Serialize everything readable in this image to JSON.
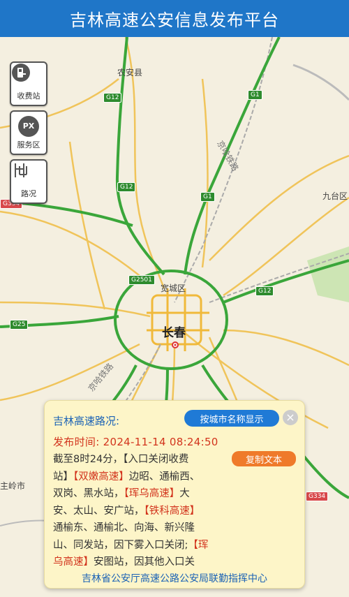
{
  "header": {
    "title": "吉林高速公安信息发布平台"
  },
  "side_buttons": [
    {
      "label": "收费站",
      "icon": "toll-station-icon"
    },
    {
      "label": "服务区",
      "icon": "service-area-icon",
      "icon_text": "PX"
    },
    {
      "label": "路况",
      "icon": "road-condition-icon"
    }
  ],
  "map": {
    "places": {
      "nongan": "农安县",
      "kuancheng": "宽城区",
      "changchun": "长春",
      "jiutai": "九台区",
      "zhuling": "主岭市",
      "railway1": "京哈铁路",
      "railway2": "京哈铁路"
    },
    "shields": {
      "g12a": "G12",
      "g12b": "G12",
      "g12c": "G12",
      "g1a": "G1",
      "g1b": "G1",
      "g2501": "G2501",
      "g25": "G25",
      "g334a": "G334",
      "g334b": "G334"
    },
    "colors": {
      "background": "#f4efe0",
      "expressway": "#3aa63a",
      "highway": "#f0c45a",
      "railway": "#999999"
    }
  },
  "panel": {
    "title": "吉林高速路况:",
    "city_button": "按城市名称显示",
    "close_icon": "close-icon",
    "time_label": "发布时间:",
    "time_value": "2024-11-14 08:24:50",
    "copy_button": "复制文本",
    "lines": [
      {
        "a": "截至8时24分，【入口关闭收费",
        "r": "",
        "b": ""
      },
      {
        "a": "站】",
        "r": "【双嫩高速】",
        "b": "边昭、通榆西、"
      },
      {
        "a": "双岗、黑水站，",
        "r": "【珲乌高速】",
        "b": "大"
      },
      {
        "a": "安、太山、安广站，",
        "r": "【铁科高速】",
        "b": ""
      },
      {
        "a": "通榆东、通榆北、向海、新兴隆",
        "r": "",
        "b": ""
      },
      {
        "a": "山、同发站，因下雾入口关闭;",
        "r": "【珲",
        "b": ""
      },
      {
        "a": "",
        "r": "乌高速】",
        "b": "安图站，因其他入口关"
      }
    ],
    "footer": "吉林省公安厅高速公路公安局联勤指挥中心"
  }
}
